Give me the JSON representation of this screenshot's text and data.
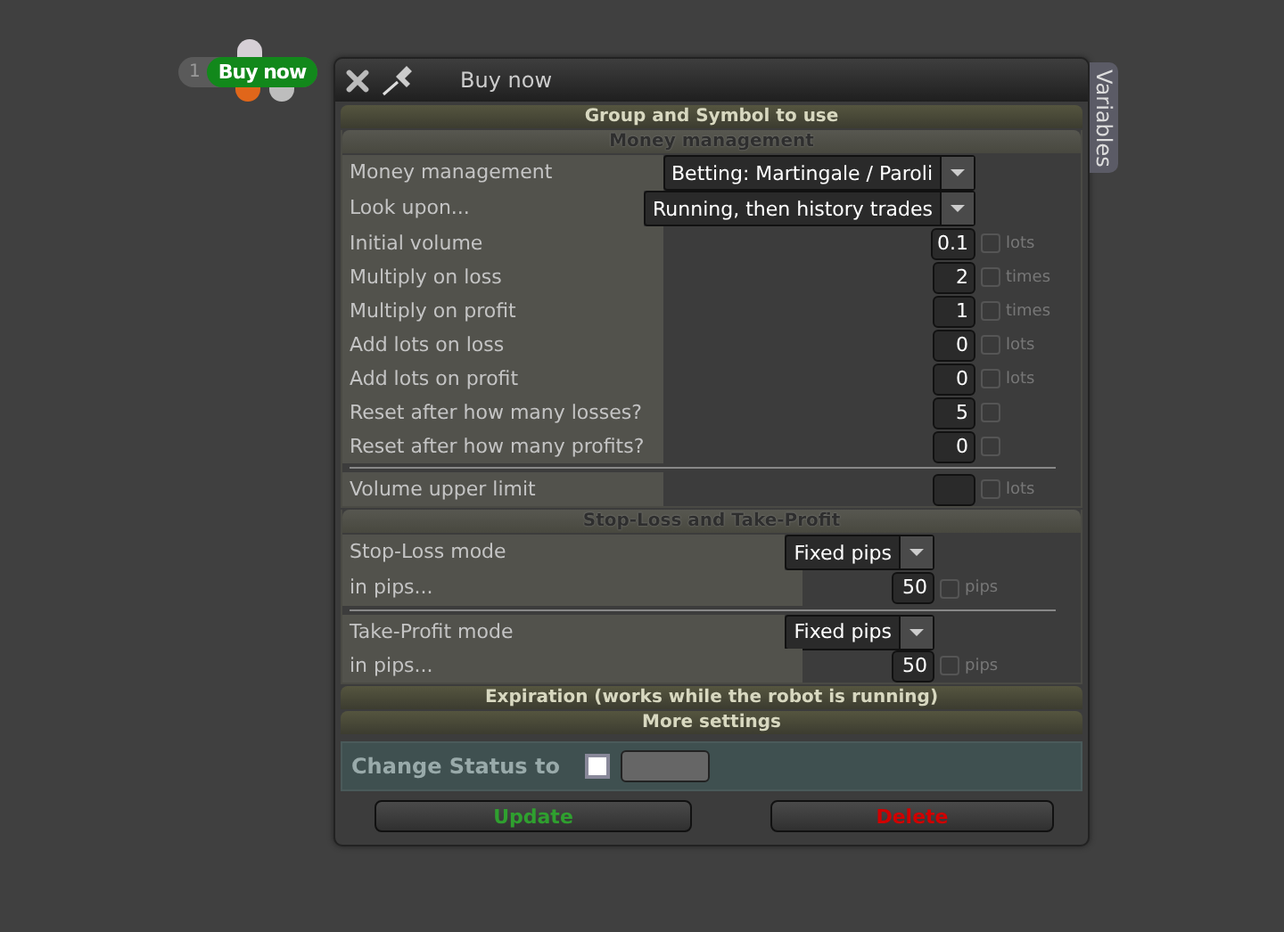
{
  "node": {
    "number": "1",
    "label": "Buy now"
  },
  "window": {
    "title": "Buy now",
    "side_tab": "Variables"
  },
  "sections": [
    {
      "title": "Group and Symbol to use",
      "kind": "header"
    },
    {
      "title": "Money management",
      "kind": "panel",
      "rows": [
        {
          "kind": "select",
          "label": "Money management",
          "value": "Betting: Martingale / Paroli"
        },
        {
          "kind": "select",
          "label": "Look upon...",
          "value": "Running, then history trades"
        },
        {
          "kind": "number",
          "label": "Initial volume",
          "value": "0.1",
          "checked": false,
          "unit": "lots"
        },
        {
          "kind": "number",
          "label": "Multiply on loss",
          "value": "2",
          "checked": false,
          "unit": "times"
        },
        {
          "kind": "number",
          "label": "Multiply on profit",
          "value": "1",
          "checked": false,
          "unit": "times"
        },
        {
          "kind": "number",
          "label": "Add lots on loss",
          "value": "0",
          "checked": false,
          "unit": "lots"
        },
        {
          "kind": "number",
          "label": "Add lots on profit",
          "value": "0",
          "checked": false,
          "unit": "lots"
        },
        {
          "kind": "number",
          "label": "Reset after how many losses?",
          "value": "5",
          "checked": false
        },
        {
          "kind": "number",
          "label": "Reset after how many profits?",
          "value": "0",
          "checked": false
        },
        {
          "kind": "divider"
        },
        {
          "kind": "number",
          "label": "Volume upper limit",
          "checked": false,
          "unit": "lots"
        }
      ]
    },
    {
      "title": "Stop-Loss and Take-Profit",
      "kind": "panel",
      "rows": [
        {
          "kind": "select",
          "label": "Stop-Loss mode",
          "value": "Fixed pips"
        },
        {
          "kind": "number",
          "label": "in pips...",
          "value": "50",
          "checked": false,
          "unit": "pips"
        },
        {
          "kind": "divider"
        },
        {
          "kind": "select",
          "label": "Take-Profit mode",
          "value": "Fixed pips"
        },
        {
          "kind": "number",
          "label": "in pips...",
          "value": "50",
          "checked": false,
          "unit": "pips"
        }
      ]
    },
    {
      "title": "Expiration (works while the robot is running)",
      "kind": "header"
    },
    {
      "title": "More settings",
      "kind": "header"
    }
  ],
  "status": {
    "label": "Change Status to",
    "checked": false
  },
  "buttons": [
    {
      "label": "Update",
      "color": "#2fa02f"
    },
    {
      "label": "Delete",
      "color": "#d00000"
    }
  ]
}
